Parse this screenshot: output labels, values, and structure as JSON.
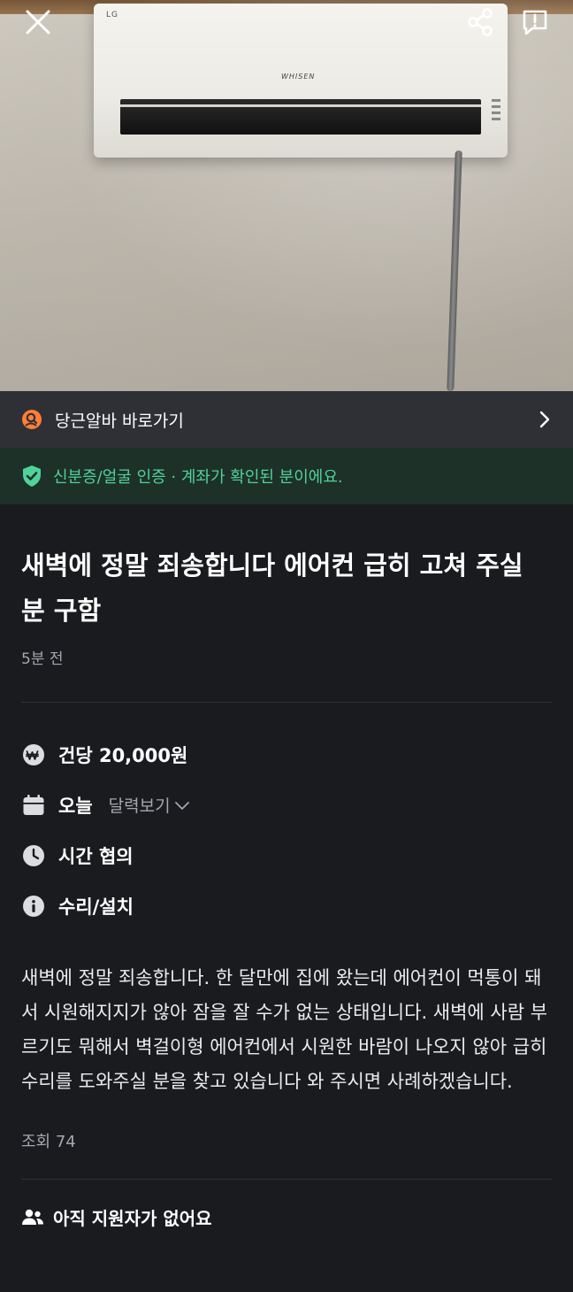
{
  "shortcut": {
    "label": "당근알바 바로가기"
  },
  "verification": {
    "label": "신분증/얼굴 인증 · 계좌가 확인된 분이에요."
  },
  "post": {
    "title": "새벽에 정말 죄송합니다 에어컨 급히 고쳐 주실 분 구함",
    "posted_time": "5분 전",
    "pay": "건당 20,000원",
    "date": "오늘",
    "calendar_link": "달력보기",
    "time": "시간 협의",
    "category": "수리/설치",
    "description": "새벽에 정말 죄송합니다. 한 달만에 집에 왔는데 에어컨이 먹통이 돼서 시원해지지가 않아 잠을 잘 수가 없는 상태입니다. 새벽에 사람 부르기도 뭐해서 벽걸이형 에어컨에서 시원한 바람이 나오지 않아 급히 수리를 도와주실 분을 찾고 있습니다 와 주시면 사례하겠습니다.",
    "views": "조회 74",
    "applicants": "아직 지원자가 없어요"
  },
  "photo": {
    "brand": "LG",
    "model": "WHISEN"
  },
  "colors": {
    "background": "#1a1b1f",
    "verify_green": "#4fd39a",
    "muted": "#a4a7ae",
    "accent_orange": "#ff7e36"
  }
}
